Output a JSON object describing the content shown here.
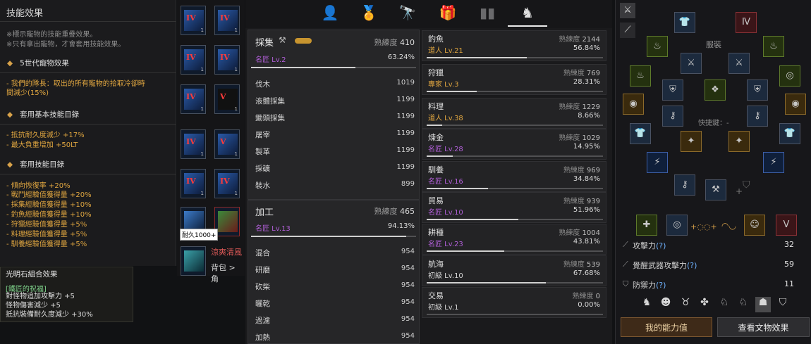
{
  "skill_effect": {
    "title": "技能效果",
    "notes": [
      "※標示寵物的技能重疊效果。",
      "※只有拿出寵物，才會套用技能效果。"
    ],
    "sections": [
      {
        "label": "5世代寵物效果",
        "lines": [
          "- 我們的隊長：取出的所有寵物的拾取冷卻時",
          "間減少(15%)"
        ]
      },
      {
        "label": "套用基本技能目錄",
        "lines": [
          "- 抵抗耐久度減少 +17%",
          "- 最大負重增加 +50LT"
        ]
      },
      {
        "label": "套用技能目錄",
        "lines": [
          "- 傾向恢復率 +20%",
          "- 戰鬥經驗值獲得量 +20%",
          "- 採集經驗值獲得量 +10%",
          "- 釣魚經驗值獲得量 +10%",
          "- 狩獵經驗值獲得量 +5%",
          "- 料理經驗值獲得量 +5%",
          "- 馴養經驗值獲得量 +5%"
        ]
      }
    ]
  },
  "lightstone": {
    "title": "光明石組合效果",
    "subtitle": "[鐵匠的祝福]",
    "lines": [
      "對怪物追加攻擊力 +5",
      "怪物傷害減少 +5",
      "抵抗裝備耐久度減少 +30%"
    ]
  },
  "item_grid": {
    "slots": [
      {
        "rank": "IV",
        "count": "1"
      },
      {
        "rank": "IV",
        "count": "1"
      },
      {
        "rank": "IV",
        "count": "1"
      },
      {
        "rank": "IV",
        "count": "1"
      },
      {
        "rank": "IV",
        "count": "1"
      },
      {
        "rank": "V",
        "count": "1"
      },
      {
        "rank": "IV",
        "count": "1"
      },
      {
        "rank": "V",
        "count": "1"
      },
      {
        "rank": "IV",
        "count": "1"
      },
      {
        "rank": "IV",
        "count": "1"
      }
    ],
    "tooltip": "耐久1000+",
    "bottom_item": "涼爽清風",
    "bottom_path": "背包 > 角"
  },
  "tabs": [
    "person-icon",
    "medal-icon",
    "telescope-icon",
    "gift-icon",
    "bar-chart-icon",
    "horse-icon"
  ],
  "center": {
    "gathering": {
      "title": "採集",
      "mastery_label": "熟練度",
      "mastery_value": "410",
      "rank": "名匠 Lv.2",
      "percent": "63.24%",
      "progress": 0.6324,
      "rows": [
        {
          "name": "伐木",
          "value": "1019"
        },
        {
          "name": "液體採集",
          "value": "1199"
        },
        {
          "name": "鋤頭採集",
          "value": "1199"
        },
        {
          "name": "屠宰",
          "value": "1199"
        },
        {
          "name": "製革",
          "value": "1199"
        },
        {
          "name": "採礦",
          "value": "1199"
        },
        {
          "name": "裝水",
          "value": "899"
        }
      ]
    },
    "processing": {
      "title": "加工",
      "mastery_label": "熟練度",
      "mastery_value": "465",
      "rank": "名匠 Lv.13",
      "percent": "94.13%",
      "progress": 0.9413,
      "rows": [
        {
          "name": "混合",
          "value": "954"
        },
        {
          "name": "研磨",
          "value": "954"
        },
        {
          "name": "砍柴",
          "value": "954"
        },
        {
          "name": "曬乾",
          "value": "954"
        },
        {
          "name": "過濾",
          "value": "954"
        },
        {
          "name": "加熱",
          "value": "954"
        }
      ]
    },
    "lifeskills": [
      {
        "name": "釣魚",
        "mastery_label": "熟練度",
        "mastery": "2144",
        "rank": "道人 Lv.21",
        "color": "#e0a640",
        "percent": "56.84%",
        "progress": 0.5684
      },
      {
        "name": "狩獵",
        "mastery_label": "熟練度",
        "mastery": "769",
        "rank": "專家 Lv.3",
        "color": "#e0a640",
        "percent": "28.31%",
        "progress": 0.2831
      },
      {
        "name": "料理",
        "mastery_label": "熟練度",
        "mastery": "1229",
        "rank": "道人 Lv.38",
        "color": "#e0a640",
        "percent": "8.66%",
        "progress": 0.0866
      },
      {
        "name": "煉金",
        "mastery_label": "熟練度",
        "mastery": "1029",
        "rank": "名匠 Lv.28",
        "color": "#b15fd8",
        "percent": "14.95%",
        "progress": 0.1495
      },
      {
        "name": "馴養",
        "mastery_label": "熟練度",
        "mastery": "969",
        "rank": "名匠 Lv.16",
        "color": "#b15fd8",
        "percent": "34.84%",
        "progress": 0.3484
      },
      {
        "name": "貿易",
        "mastery_label": "熟練度",
        "mastery": "939",
        "rank": "名匠 Lv.10",
        "color": "#b15fd8",
        "percent": "51.96%",
        "progress": 0.5196
      },
      {
        "name": "耕種",
        "mastery_label": "熟練度",
        "mastery": "1004",
        "rank": "名匠 Lv.23",
        "color": "#b15fd8",
        "percent": "43.81%",
        "progress": 0.4381
      },
      {
        "name": "航海",
        "mastery_label": "熟練度",
        "mastery": "539",
        "rank": "初級 Lv.10",
        "color": "#d8d8d8",
        "percent": "67.68%",
        "progress": 0.6768
      },
      {
        "name": "交易",
        "mastery_label": "熟練度",
        "mastery": "0",
        "rank": "初級 Lv.1",
        "color": "#d8d8d8",
        "percent": "0.00%",
        "progress": 0
      }
    ]
  },
  "equip": {
    "label": "服裝",
    "hotkey": "快捷鍵：-",
    "stats": [
      {
        "label": "攻擊力",
        "q": "(?)",
        "value": "32"
      },
      {
        "label": "覺醒武器攻擊力",
        "q": "(?)",
        "value": "59"
      },
      {
        "label": "防禦力",
        "q": "(?)",
        "value": "11"
      }
    ],
    "buttons": {
      "my_stats": "我的能力值",
      "view_artifacts": "查看文物效果"
    }
  }
}
